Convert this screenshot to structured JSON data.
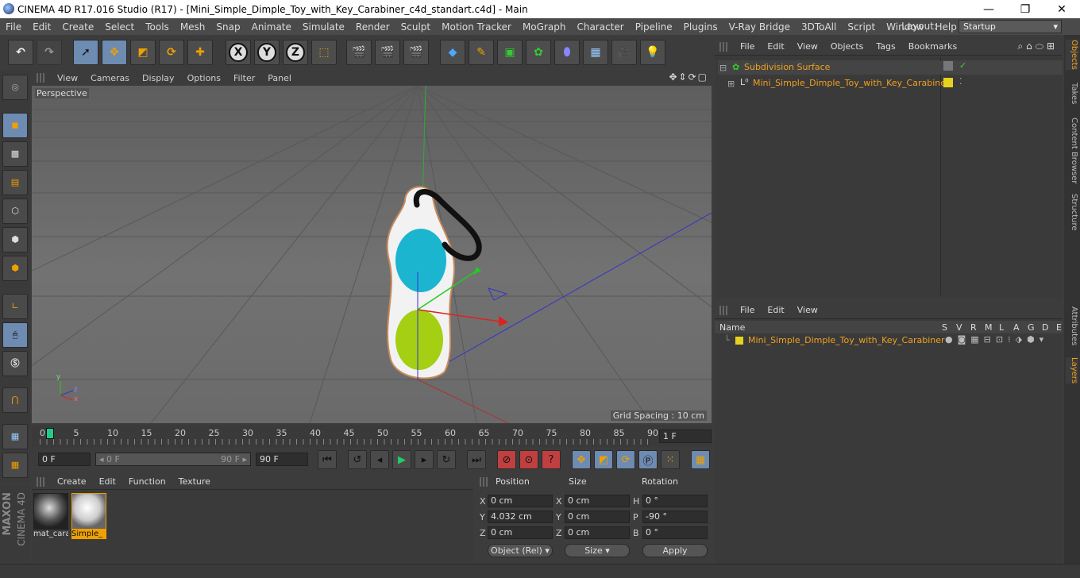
{
  "window": {
    "title": "CINEMA 4D R17.016 Studio (R17) - [Mini_Simple_Dimple_Toy_with_Key_Carabiner_c4d_standart.c4d] - Main",
    "minimize": "—",
    "maximize": "❐",
    "close": "✕"
  },
  "menu": [
    "File",
    "Edit",
    "Create",
    "Select",
    "Tools",
    "Mesh",
    "Snap",
    "Animate",
    "Simulate",
    "Render",
    "Sculpt",
    "Motion Tracker",
    "MoGraph",
    "Character",
    "Pipeline",
    "Plugins",
    "V-Ray Bridge",
    "3DToAll",
    "Script",
    "Window",
    "Help"
  ],
  "layout": {
    "label": "Layout:",
    "value": "Startup"
  },
  "toolbar": {
    "x": "X",
    "y": "Y",
    "z": "Z"
  },
  "viewport": {
    "menu": [
      "View",
      "Cameras",
      "Display",
      "Options",
      "Filter",
      "Panel"
    ],
    "camera": "Perspective",
    "grid_spacing": "Grid Spacing : 10 cm",
    "axis_y": "y",
    "axis_z": "z",
    "axis_x": "x"
  },
  "timeline": {
    "ticks": [
      "0",
      "5",
      "10",
      "15",
      "20",
      "25",
      "30",
      "35",
      "40",
      "45",
      "50",
      "55",
      "60",
      "65",
      "70",
      "75",
      "80",
      "85",
      "90"
    ],
    "current": "1 F"
  },
  "transport": {
    "start": "0 F",
    "slider_left": "◂ 0 F",
    "slider_right": "90 F ▸",
    "end": "90 F"
  },
  "materials": {
    "menu": [
      "Create",
      "Edit",
      "Function",
      "Texture"
    ],
    "items": [
      {
        "label": "mat_cara"
      },
      {
        "label": "Simple_"
      }
    ]
  },
  "coords": {
    "headers": {
      "position": "Position",
      "size": "Size",
      "rotation": "Rotation"
    },
    "rows": [
      {
        "axis": "X",
        "pos": "0 cm",
        "size_axis": "X",
        "size": "0 cm",
        "rot_axis": "H",
        "rot": "0 °"
      },
      {
        "axis": "Y",
        "pos": "4.032 cm",
        "size_axis": "Y",
        "size": "0 cm",
        "rot_axis": "P",
        "rot": "-90 °"
      },
      {
        "axis": "Z",
        "pos": "0 cm",
        "size_axis": "Z",
        "size": "0 cm",
        "rot_axis": "B",
        "rot": "0 °"
      }
    ],
    "mode": "Object (Rel)",
    "size_mode": "Size",
    "apply": "Apply"
  },
  "objects": {
    "menu": [
      "File",
      "Edit",
      "View",
      "Objects",
      "Tags",
      "Bookmarks"
    ],
    "items": [
      {
        "name": "Subdivision Surface"
      },
      {
        "name": "Mini_Simple_Dimple_Toy_with_Key_Carabiner"
      }
    ]
  },
  "layers": {
    "menu": [
      "File",
      "Edit",
      "View"
    ],
    "col_name": "Name",
    "cols": [
      "S",
      "V",
      "R",
      "M",
      "L",
      "A",
      "G",
      "D",
      "E"
    ],
    "items": [
      {
        "name": "Mini_Simple_Dimple_Toy_with_Key_Carabiner"
      }
    ]
  },
  "right_tabs": [
    "Objects",
    "Takes",
    "Content Browser",
    "Structure",
    "Attributes",
    "Layers"
  ],
  "brand": {
    "maxon": "MAXON",
    "c4d": "CINEMA 4D"
  },
  "colors": {
    "accent": "#6e8bb1",
    "object_name": "#f0a020",
    "layer_yellow": "#e6d21e"
  }
}
